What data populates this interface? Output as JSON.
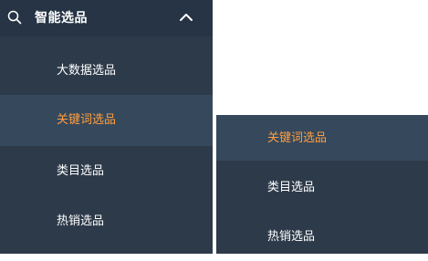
{
  "sidebar": {
    "group_title": "智能选品",
    "icons": {
      "search": "search-icon",
      "chevron": "chevron-up-icon"
    },
    "items": [
      {
        "label": "大数据选品",
        "active": false
      },
      {
        "label": "关键词选品",
        "active": true
      },
      {
        "label": "类目选品",
        "active": false
      },
      {
        "label": "热销选品",
        "active": false
      }
    ]
  },
  "panel": {
    "items": [
      {
        "label": "关键词选品",
        "active": true
      },
      {
        "label": "类目选品",
        "active": false
      },
      {
        "label": "热销选品",
        "active": false
      }
    ]
  },
  "colors": {
    "sidebar_bg": "#2d3a4a",
    "header_bg": "#263445",
    "active_bg": "#36485c",
    "active_text": "#ff9f3f",
    "text": "#ffffff"
  }
}
